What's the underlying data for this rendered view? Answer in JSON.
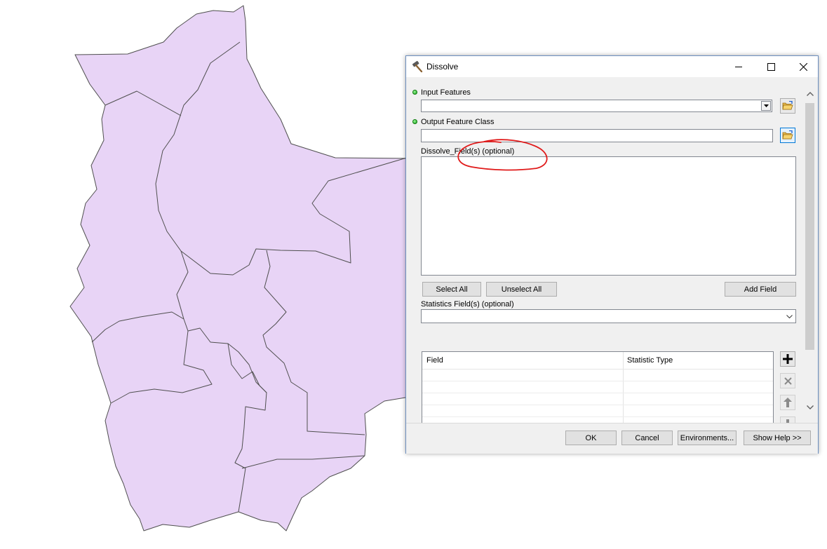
{
  "dialog": {
    "title": "Dissolve",
    "input_features": {
      "label": "Input Features",
      "value": ""
    },
    "output_feature_class": {
      "label": "Output Feature Class",
      "value": ""
    },
    "dissolve_fields": {
      "label": "Dissolve_Field(s) (optional)",
      "items": []
    },
    "field_buttons": {
      "select_all": "Select All",
      "unselect_all": "Unselect All",
      "add_field": "Add Field"
    },
    "statistics_fields": {
      "label": "Statistics Field(s) (optional)",
      "value": "",
      "columns": [
        "Field",
        "Statistic Type"
      ],
      "rows": []
    },
    "footer": {
      "ok": "OK",
      "cancel": "Cancel",
      "environments": "Environments...",
      "show_help": "Show Help >>"
    }
  },
  "colors": {
    "map_fill": "#e8d4f6",
    "map_stroke": "#4f4f4f",
    "annotation_red": "#e01a1a",
    "dialog_border": "#6d8fbf",
    "dialog_bg": "#f0f0f0"
  },
  "icons": {
    "title": "hammer-icon",
    "required": "green-dot-icon",
    "browse": "open-folder-icon",
    "add": "plus-icon",
    "remove": "x-icon",
    "up": "arrow-up-icon",
    "down": "arrow-down-icon"
  }
}
